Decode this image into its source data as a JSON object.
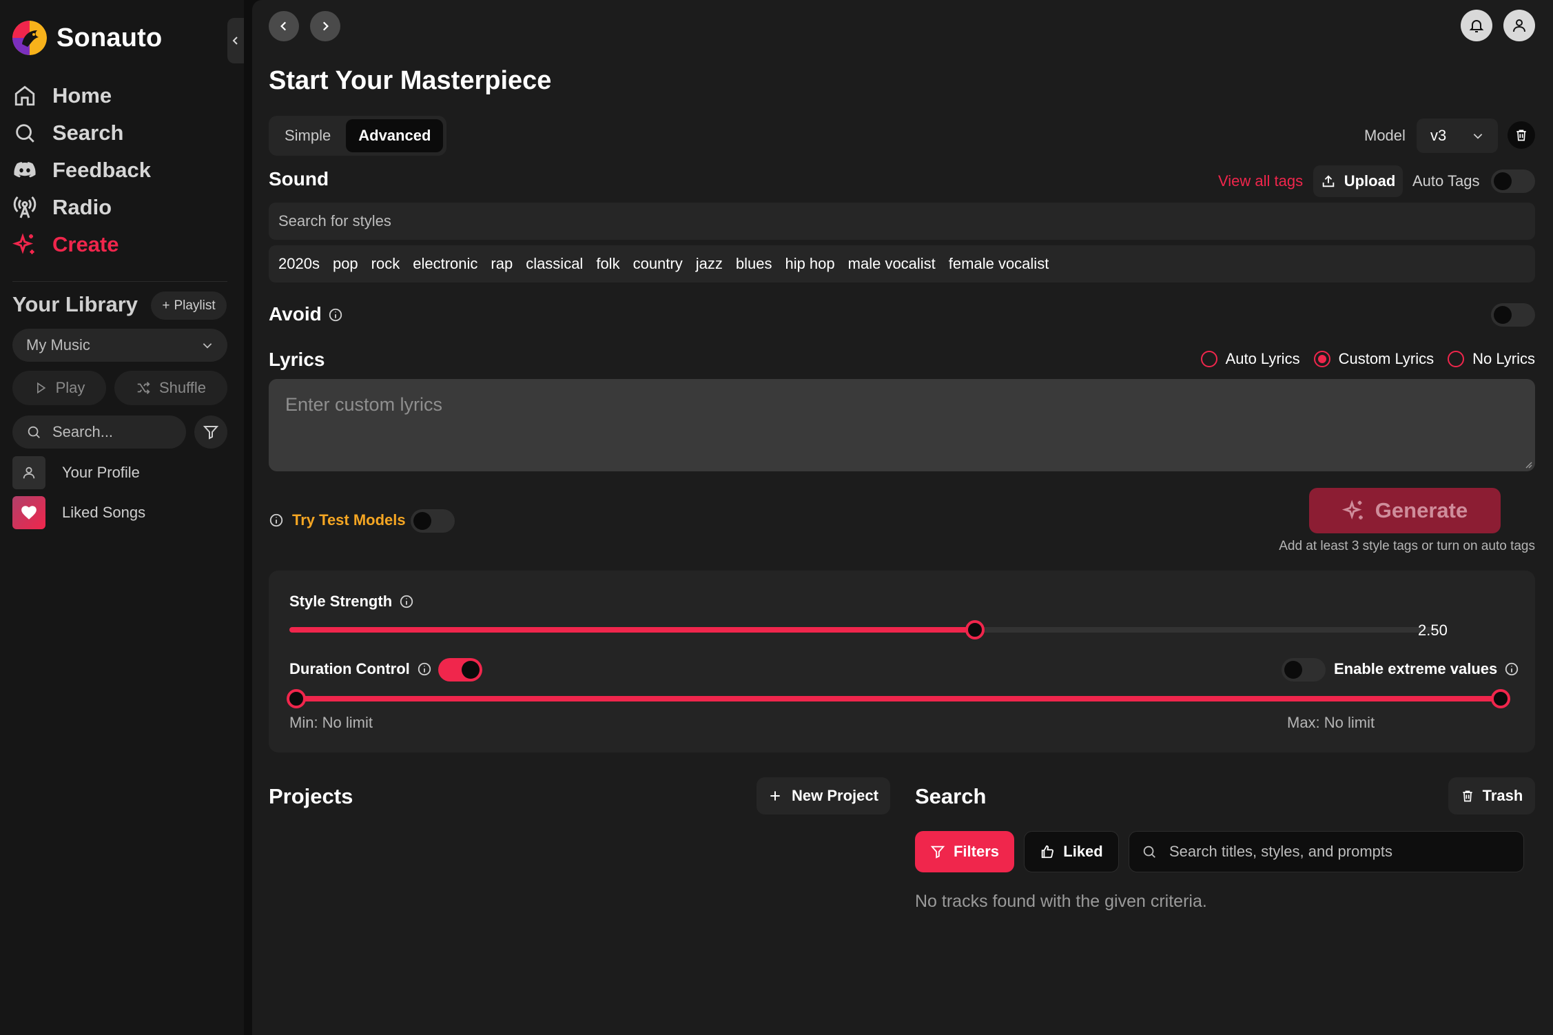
{
  "app": {
    "name": "Sonauto"
  },
  "sidebar": {
    "nav": [
      {
        "label": "Home",
        "icon": "home-icon"
      },
      {
        "label": "Search",
        "icon": "search-icon"
      },
      {
        "label": "Feedback",
        "icon": "discord-icon"
      },
      {
        "label": "Radio",
        "icon": "radio-icon"
      },
      {
        "label": "Create",
        "icon": "sparkles-icon",
        "active": true
      }
    ],
    "library": {
      "title": "Your Library",
      "playlist_button": "Playlist",
      "filter_select": "My Music",
      "play_label": "Play",
      "shuffle_label": "Shuffle",
      "search_placeholder": "Search...",
      "items": [
        {
          "label": "Your Profile",
          "icon": "user-icon"
        },
        {
          "label": "Liked Songs",
          "icon": "heart-icon"
        }
      ]
    }
  },
  "main": {
    "title": "Start Your Masterpiece",
    "mode_tabs": [
      {
        "label": "Simple"
      },
      {
        "label": "Advanced",
        "active": true
      }
    ],
    "model": {
      "label": "Model",
      "value": "v3"
    },
    "sound": {
      "label": "Sound",
      "view_all_tags": "View all tags",
      "upload_label": "Upload",
      "auto_tags_label": "Auto Tags",
      "auto_tags_on": false,
      "search_placeholder": "Search for styles",
      "tags": [
        "2020s",
        "pop",
        "rock",
        "electronic",
        "rap",
        "classical",
        "folk",
        "country",
        "jazz",
        "blues",
        "hip hop",
        "male vocalist",
        "female vocalist"
      ]
    },
    "avoid": {
      "label": "Avoid",
      "enabled": false
    },
    "lyrics": {
      "label": "Lyrics",
      "options": [
        {
          "label": "Auto Lyrics",
          "selected": false
        },
        {
          "label": "Custom Lyrics",
          "selected": true
        },
        {
          "label": "No Lyrics",
          "selected": false
        }
      ],
      "placeholder": "Enter custom lyrics"
    },
    "test_models": {
      "label": "Try Test Models",
      "enabled": false
    },
    "generate": {
      "label": "Generate",
      "hint": "Add at least 3 style tags or turn on auto tags"
    },
    "settings": {
      "style_strength": {
        "label": "Style Strength",
        "value_text": "2.50",
        "fraction": 0.597
      },
      "duration_control": {
        "label": "Duration Control",
        "enabled": true,
        "min_label": "Min: No limit",
        "max_label": "Max: No limit"
      },
      "extreme_values": {
        "label": "Enable extreme values",
        "enabled": false
      }
    },
    "projects": {
      "title": "Projects",
      "new_button": "New Project"
    },
    "search": {
      "title": "Search",
      "trash_label": "Trash",
      "filters_label": "Filters",
      "liked_label": "Liked",
      "placeholder": "Search titles, styles, and prompts",
      "empty_message": "No tracks found with the given criteria."
    }
  },
  "colors": {
    "accent": "#f0264c",
    "warning": "#f5a623",
    "generate_disabled": "#8c1d33"
  }
}
